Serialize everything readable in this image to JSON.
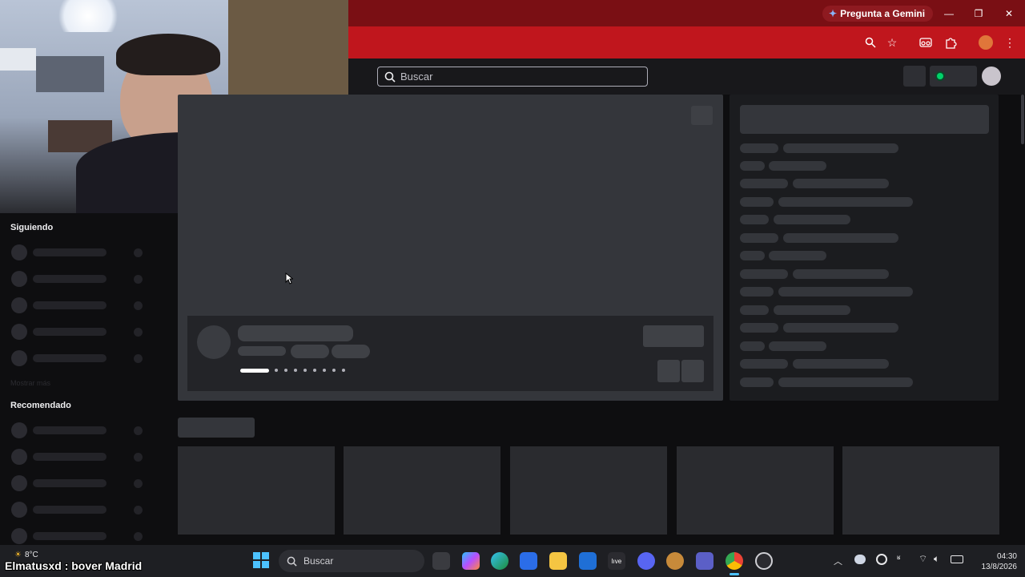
{
  "browser": {
    "gemini_label": "Pregunta a Gemini"
  },
  "header": {
    "search_placeholder": "Buscar"
  },
  "sidebar": {
    "following_title": "Siguiendo",
    "show_more": "Mostrar más",
    "recommended_title": "Recomendado"
  },
  "overlay": {
    "chat_line": "Elmatusxd : bover Madrid"
  },
  "taskbar": {
    "weather": "8°C",
    "search_label": "Buscar",
    "time": "04:30",
    "date": "13/8/2026"
  },
  "colors": {
    "chrome_title": "#7a0f14",
    "chrome_toolbar": "#c0161d",
    "page_bg": "#0e0e10",
    "skeleton": "#34363b",
    "live_indicator": "#00d26a"
  }
}
